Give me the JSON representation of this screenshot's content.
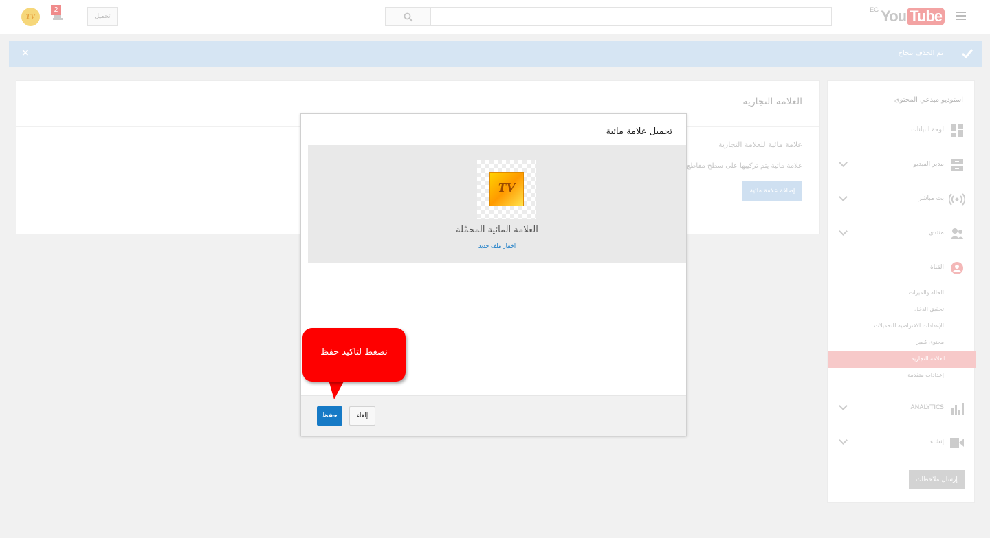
{
  "header": {
    "logo_you": "You",
    "logo_tube": "Tube",
    "logo_region": "EG",
    "upload_label": "تحميل",
    "notification_count": "2",
    "avatar_text": "TV"
  },
  "banner": {
    "message": "تم الحذف بنجاح",
    "close_label": "×"
  },
  "panel": {
    "title": "العلامة التجارية",
    "watermark_label": "علامة مائية للعلامة التجارية",
    "watermark_desc": "علامة مائية يتم تركيبها على سطح مقاطع",
    "add_button": "إضافة علامة مائية"
  },
  "sidebar": {
    "title": "استوديو مبدعي المحتوى",
    "items": [
      {
        "label": "لوحة البيانات",
        "icon": "dashboard-icon"
      },
      {
        "label": "مدير الفيديو",
        "icon": "video-manager-icon"
      },
      {
        "label": "بث مباشر",
        "icon": "live-icon"
      },
      {
        "label": "منتدى",
        "icon": "community-icon"
      },
      {
        "label": "القناة",
        "icon": "channel-icon"
      },
      {
        "label": "ANALYTICS",
        "icon": "analytics-icon"
      },
      {
        "label": "إنشاء",
        "icon": "create-icon"
      }
    ],
    "channel_sub": [
      {
        "label": "الحالة والميزات"
      },
      {
        "label": "تحقيق الدخل"
      },
      {
        "label": "الإعدادات الافتراضية للتحميلات"
      },
      {
        "label": "محتوى مُميز"
      },
      {
        "label": "العلامة التجارية",
        "active": true
      },
      {
        "label": "إعدادات متقدمة"
      }
    ],
    "feedback_button": "إرسال ملاحظات"
  },
  "modal": {
    "title": "تحميل علامة مائية",
    "preview_caption": "العلامة المائية المحمّلة",
    "choose_file_link": "اختيار ملف جديد",
    "logo_text": "TV",
    "save_button": "حفظ",
    "cancel_button": "إلغاء"
  },
  "callout": {
    "text": "نضغط لتاكيد حفظ"
  },
  "colors": {
    "accent_blue": "#167ac6",
    "callout_red": "#fe0000",
    "banner_blue": "#d6e5f3"
  }
}
